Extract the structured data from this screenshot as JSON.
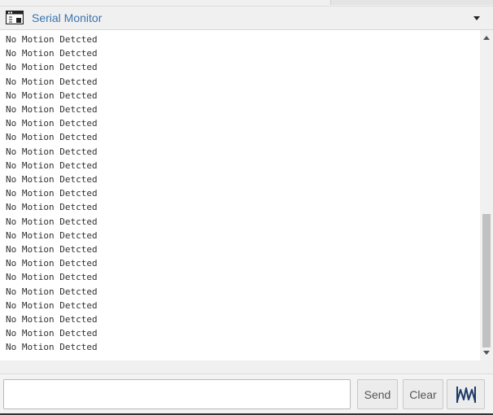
{
  "panel": {
    "title": "Serial Monitor",
    "icons": {
      "window": "serial-window-icon",
      "menu": "dropdown-triangle-icon",
      "plotter": "waveform-icon"
    }
  },
  "output": {
    "lines": [
      "No Motion Detcted",
      "No Motion Detcted",
      "No Motion Detcted",
      "No Motion Detcted",
      "No Motion Detcted",
      "No Motion Detcted",
      "No Motion Detcted",
      "No Motion Detcted",
      "No Motion Detcted",
      "No Motion Detcted",
      "No Motion Detcted",
      "No Motion Detcted",
      "No Motion Detcted",
      "No Motion Detcted",
      "No Motion Detcted",
      "No Motion Detcted",
      "No Motion Detcted",
      "No Motion Detcted",
      "No Motion Detcted",
      "No Motion Detcted",
      "No Motion Detcted",
      "No Motion Detcted",
      "No Motion Detcted"
    ]
  },
  "input": {
    "value": "",
    "placeholder": ""
  },
  "buttons": {
    "send": "Send",
    "clear": "Clear"
  },
  "colors": {
    "title": "#3b74b0",
    "background": "#f0f0f0",
    "output_background": "#ffffff",
    "scroll_thumb": "#c1c1c1"
  }
}
